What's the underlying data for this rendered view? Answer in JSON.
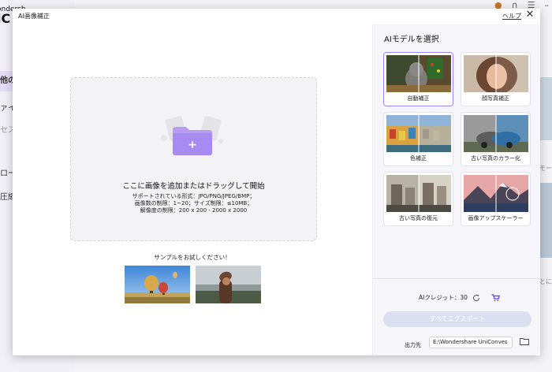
{
  "background_app": {
    "logo_small": "ondersh",
    "logo_big": "iC",
    "nav": [
      "他のツ",
      "ァイル",
      "セス",
      "ロー",
      "圧縮"
    ],
    "right_text_1": "モー",
    "right_text_2": "とに"
  },
  "dialog": {
    "title": "AI画像補正",
    "help": "ヘルプ",
    "close": "✕"
  },
  "dropzone": {
    "main": "ここに画像を追加またはドラッグして開始",
    "lines": [
      "サポートされている形式：JPG/PNG/JPEG/BMP；",
      "画像数の制限：1~20；サイズ制限：≤10MB；",
      "解像度の制限：200 x 200 - 2000 x 2000"
    ],
    "plus": "+"
  },
  "samples": {
    "title": "サンプルをお試しください！"
  },
  "models": {
    "heading": "AIモデルを選択",
    "items": [
      {
        "label": "自動補正",
        "selected": true
      },
      {
        "label": "顔写真補正",
        "selected": false
      },
      {
        "label": "色補正",
        "selected": false
      },
      {
        "label": "古い写真のカラー化",
        "selected": false
      },
      {
        "label": "古い写真の復元",
        "selected": false
      },
      {
        "label": "画像アップスケーラー",
        "selected": false
      }
    ]
  },
  "footer": {
    "credits_label": "AIクレジット：30",
    "export_label": "すべてエクスポート",
    "output_label": "出力先",
    "output_path": "E:\\Wondershare UniConver"
  },
  "colors": {
    "accent": "#9c86f0",
    "folder": "#b79cf2",
    "cart": "#5a3ee6"
  }
}
